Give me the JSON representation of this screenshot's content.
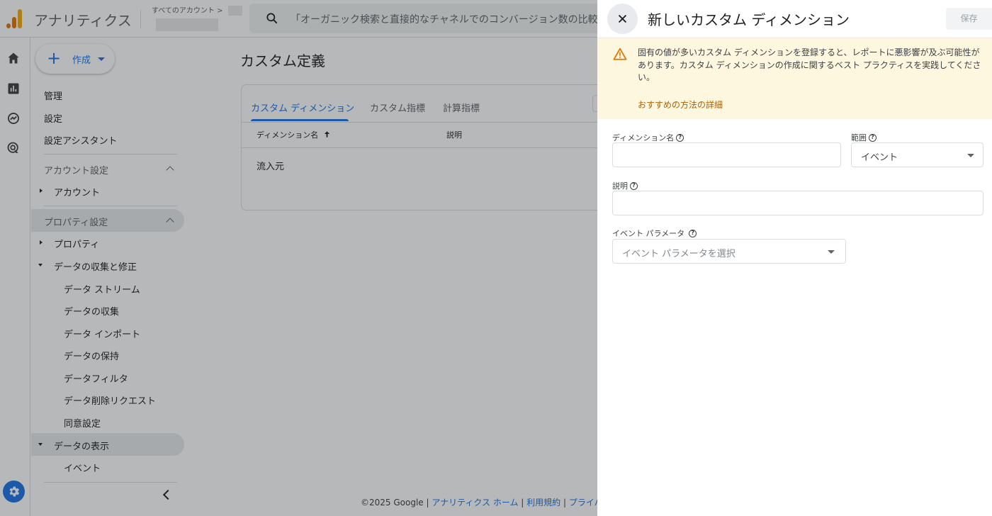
{
  "app": {
    "name": "アナリティクス",
    "account_crumb": "すべてのアカウント >",
    "search_placeholder": "「オーガニック検索と直接的なチャネルでのコンバージョン数の比較」"
  },
  "sidenav": {
    "create_label": "作成",
    "top_items": [
      "管理",
      "設定",
      "設定アシスタント"
    ],
    "account_section": "アカウント設定",
    "account_item": "アカウント",
    "property_section": "プロパティ設定",
    "property_item": "プロパティ",
    "collection_item": "データの収集と修正",
    "collection_subitems": [
      "データ ストリーム",
      "データの収集",
      "データ インポート",
      "データの保持",
      "データフィルタ",
      "データ削除リクエスト",
      "同意設定"
    ],
    "display_item": "データの表示",
    "display_subitems": [
      "イベント"
    ]
  },
  "main": {
    "title": "カスタム定義",
    "tabs": [
      "カスタム ディメンション",
      "カスタム指標",
      "計算指標"
    ],
    "active_tab": 0,
    "columns": [
      "ディメンション名",
      "説明"
    ],
    "rows": [
      [
        "流入元",
        ""
      ]
    ]
  },
  "footer": {
    "copyright": "©2025 Google | ",
    "link1": "アナリティクス ホーム",
    "sep1": " | ",
    "link2": "利用規約",
    "sep2": " | ",
    "link3": "プライバ"
  },
  "panel": {
    "title": "新しいカスタム ディメンション",
    "save_label": "保存",
    "warning_text": "固有の値が多いカスタム ディメンションを登録すると、レポートに悪影響が及ぶ可能性があります。カスタム ディメンションの作成に関するベスト プラクティスを実践してください。",
    "warning_link": "おすすめの方法の詳細",
    "dimension_name_label": "ディメンション名",
    "dimension_name_value": "",
    "scope_label": "範囲",
    "scope_value": "イベント",
    "description_label": "説明",
    "description_value": "",
    "event_param_label": "イベント パラメータ",
    "event_param_placeholder": "イベント パラメータを選択"
  },
  "colors": {
    "accent": "#1a73e8",
    "warning_bg": "#fef7e0",
    "warning_icon": "#e37400",
    "warning_link": "#b06000"
  }
}
